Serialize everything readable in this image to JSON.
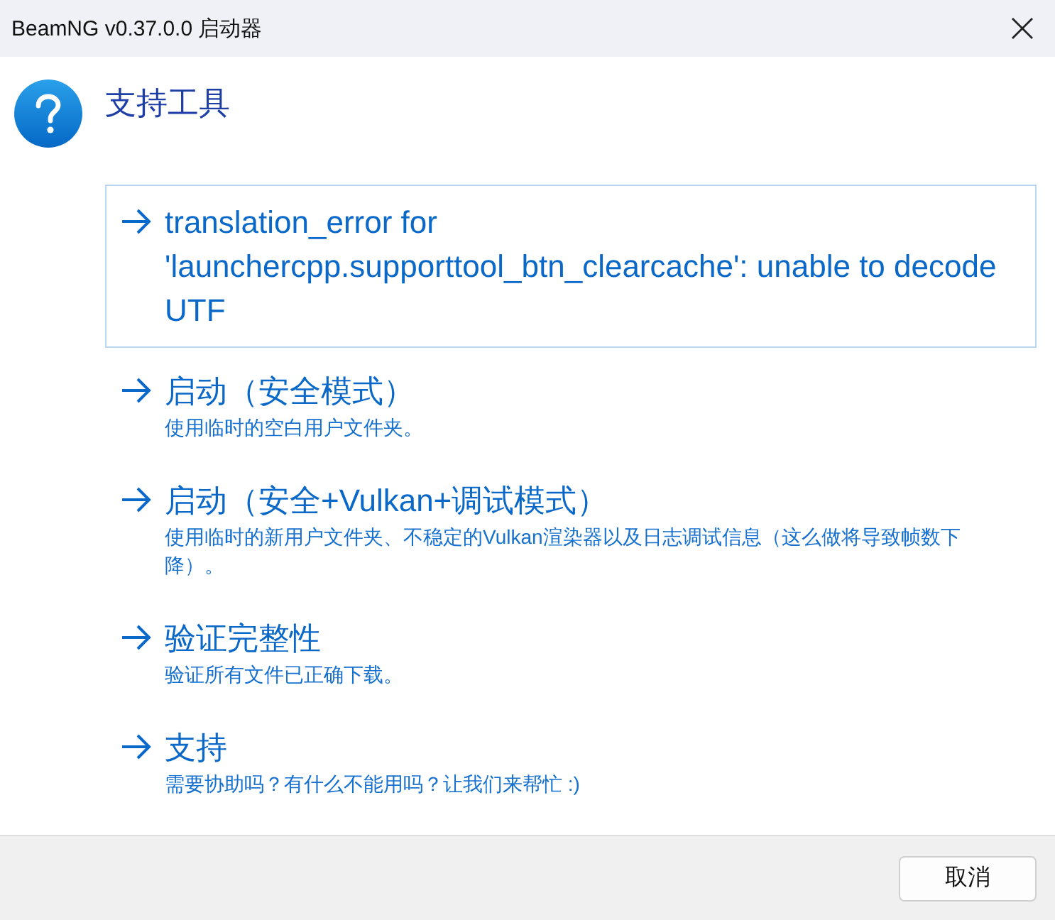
{
  "window": {
    "title": "BeamNG v0.37.0.0 启动器"
  },
  "header": {
    "title": "支持工具"
  },
  "commands": [
    {
      "label": "translation_error for 'launchercpp.supporttool_btn_clearcache': unable to decode UTF",
      "focused": true
    },
    {
      "label": "启动（安全模式）",
      "note": "使用临时的空白用户文件夹。",
      "focused": false
    },
    {
      "label": "启动（安全+Vulkan+调试模式）",
      "note": "使用临时的新用户文件夹、不稳定的Vulkan渲染器以及日志调试信息（这么做将导致帧数下降）。",
      "focused": false
    },
    {
      "label": "验证完整性",
      "note": "验证所有文件已正确下载。",
      "focused": false
    },
    {
      "label": "支持",
      "note": "需要协助吗？有什么不能用吗？让我们来帮忙 :)",
      "focused": false
    }
  ],
  "buttons": [
    {
      "label": "取消"
    }
  ]
}
